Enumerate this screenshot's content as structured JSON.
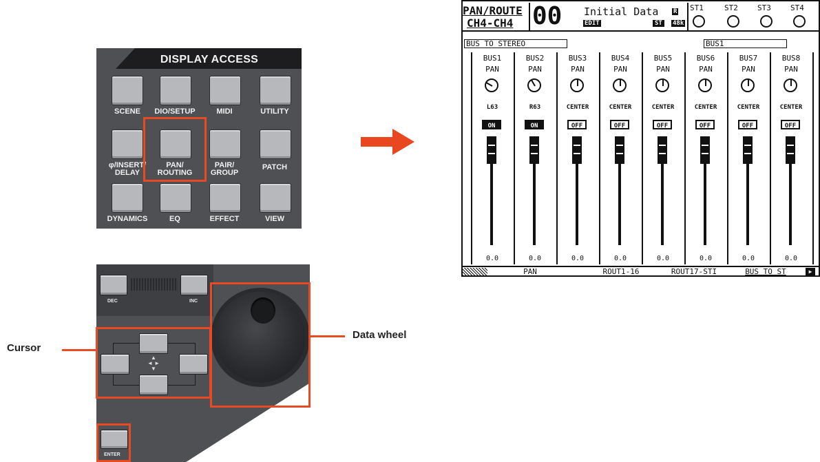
{
  "display_access": {
    "title": "DISPLAY ACCESS",
    "keys": [
      {
        "label": "SCENE"
      },
      {
        "label": "DIO/SETUP"
      },
      {
        "label": "MIDI"
      },
      {
        "label": "UTILITY"
      },
      {
        "label": "φ/INSERT/\nDELAY"
      },
      {
        "label": "PAN/\nROUTING"
      },
      {
        "label": "PAIR/\nGROUP"
      },
      {
        "label": "PATCH"
      },
      {
        "label": "DYNAMICS"
      },
      {
        "label": "EQ"
      },
      {
        "label": "EFFECT"
      },
      {
        "label": "VIEW"
      }
    ]
  },
  "controls": {
    "dec_label": "DEC",
    "inc_label": "INC",
    "enter_label": "ENTER",
    "cursor_callout": "Cursor",
    "wheel_callout": "Data wheel"
  },
  "lcd": {
    "page_title": "PAN/ROUTE",
    "channel_range": "CH4-CH4",
    "scene_number": "00",
    "scene_title": "Initial Data",
    "edit_badge": "EDIT",
    "r_badge": "R",
    "st_badge": "ST",
    "rate_badge": "48k",
    "st_labels": [
      "ST1",
      "ST2",
      "ST3",
      "ST4"
    ],
    "section_label": "BUS TO STEREO",
    "selected_bus": "BUS1",
    "strips": [
      {
        "name": "BUS1",
        "sub": "PAN",
        "value": "L63",
        "state": "ON",
        "level": "0.0",
        "knob_deg": -60
      },
      {
        "name": "BUS2",
        "sub": "PAN",
        "value": "R63",
        "state": "ON",
        "level": "0.0",
        "knob_deg": -30
      },
      {
        "name": "BUS3",
        "sub": "PAN",
        "value": "CENTER",
        "state": "OFF",
        "level": "0.0",
        "knob_deg": 0
      },
      {
        "name": "BUS4",
        "sub": "PAN",
        "value": "CENTER",
        "state": "OFF",
        "level": "0.0",
        "knob_deg": 0
      },
      {
        "name": "BUS5",
        "sub": "PAN",
        "value": "CENTER",
        "state": "OFF",
        "level": "0.0",
        "knob_deg": 0
      },
      {
        "name": "BUS6",
        "sub": "PAN",
        "value": "CENTER",
        "state": "OFF",
        "level": "0.0",
        "knob_deg": 0
      },
      {
        "name": "BUS7",
        "sub": "PAN",
        "value": "CENTER",
        "state": "OFF",
        "level": "0.0",
        "knob_deg": 0
      },
      {
        "name": "BUS8",
        "sub": "PAN",
        "value": "CENTER",
        "state": "OFF",
        "level": "0.0",
        "knob_deg": 0
      }
    ],
    "tabs": [
      "PAN",
      "ROUT1-16",
      "ROUT17-STI",
      "BUS TO ST"
    ]
  }
}
